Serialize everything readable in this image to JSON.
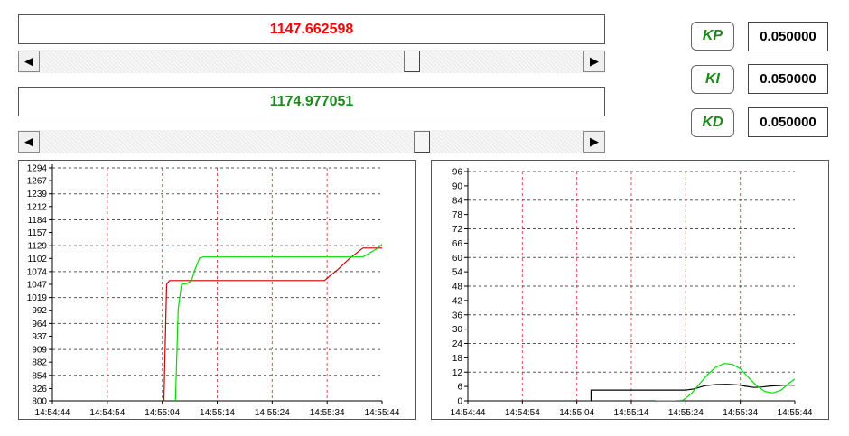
{
  "setpoint": {
    "value": "1147.662598",
    "color": "#ff0000",
    "slider_fraction": 0.69
  },
  "process_value": {
    "value": "1174.977051",
    "color": "#1a8a1a",
    "slider_fraction": 0.71
  },
  "gains": [
    {
      "label": "KP",
      "value": "0.050000"
    },
    {
      "label": "KI",
      "value": "0.050000"
    },
    {
      "label": "KD",
      "value": "0.050000"
    }
  ],
  "colors": {
    "red_series": "#cc0000",
    "green_series": "#00dd00",
    "black_series": "#000000",
    "grid_v": "#e05050",
    "grid_h": "#555555"
  },
  "icons": {
    "left_arrow": "triangle-left-icon",
    "right_arrow": "triangle-right-icon"
  },
  "chart_data": [
    {
      "type": "line",
      "x_ticks": [
        "14:54:44",
        "14:54:54",
        "14:55:04",
        "14:55:14",
        "14:55:24",
        "14:55:34",
        "14:55:44"
      ],
      "y_ticks": [
        800,
        826,
        854,
        882,
        909,
        937,
        964,
        992,
        1019,
        1047,
        1074,
        1102,
        1129,
        1157,
        1184,
        1212,
        1239,
        1267,
        1294
      ],
      "ylim": [
        800,
        1294
      ],
      "xlim": [
        0,
        60
      ],
      "grid": true,
      "series": [
        {
          "color": "#cc0000",
          "points": [
            [
              20.3,
              800
            ],
            [
              20.8,
              1047
            ],
            [
              21.3,
              1055
            ],
            [
              49.5,
              1055
            ],
            [
              52,
              1079
            ],
            [
              54,
              1101
            ],
            [
              56.5,
              1124
            ],
            [
              57.5,
              1124
            ],
            [
              60,
              1124
            ],
            [
              63,
              1124
            ],
            [
              66,
              1124
            ],
            [
              70,
              1124
            ],
            [
              72,
              1124
            ],
            [
              75,
              1124
            ],
            [
              76,
              1124
            ],
            [
              78,
              1124
            ],
            [
              82,
              1124
            ],
            [
              85,
              1124
            ],
            [
              90,
              1124
            ]
          ]
        },
        {
          "color": "#00dd00",
          "points": [
            [
              22.4,
              800
            ],
            [
              22.9,
              994
            ],
            [
              23.5,
              1047
            ],
            [
              24.5,
              1049
            ],
            [
              25.3,
              1054
            ],
            [
              26,
              1080
            ],
            [
              26.8,
              1103
            ],
            [
              27.5,
              1105
            ],
            [
              52,
              1105
            ],
            [
              56.5,
              1105
            ],
            [
              59,
              1122
            ],
            [
              61,
              1141
            ],
            [
              63.5,
              1162
            ],
            [
              65,
              1162
            ]
          ]
        }
      ]
    },
    {
      "type": "line",
      "x_ticks": [
        "14:54:44",
        "14:54:54",
        "14:55:04",
        "14:55:14",
        "14:55:24",
        "14:55:34",
        "14:55:44"
      ],
      "y_ticks": [
        0,
        6,
        12,
        18,
        24,
        30,
        36,
        42,
        48,
        54,
        60,
        66,
        72,
        78,
        84,
        90,
        96
      ],
      "ylim": [
        0,
        96
      ],
      "xlim": [
        0,
        60
      ],
      "grid": true,
      "series": [
        {
          "color": "#000000",
          "points": [
            [
              22.6,
              0
            ],
            [
              22.6,
              4.5
            ],
            [
              40,
              4.5
            ],
            [
              41.5,
              5
            ],
            [
              43.5,
              6.3
            ],
            [
              45.5,
              6.8
            ],
            [
              47.5,
              6.9
            ],
            [
              49.5,
              6.7
            ],
            [
              51,
              6.1
            ],
            [
              52.5,
              5.6
            ],
            [
              54,
              5.8
            ],
            [
              55.5,
              6.2
            ],
            [
              57,
              6.4
            ],
            [
              58.5,
              6.6
            ],
            [
              60,
              6.5
            ]
          ]
        },
        {
          "color": "#00dd00",
          "points": [
            [
              34.5,
              0
            ],
            [
              38,
              0
            ],
            [
              39.5,
              0.3
            ],
            [
              41,
              3
            ],
            [
              42.5,
              7
            ],
            [
              44,
              11
            ],
            [
              45.5,
              14.1
            ],
            [
              47,
              15.6
            ],
            [
              48.5,
              15.3
            ],
            [
              50,
              13.4
            ],
            [
              51.5,
              9.8
            ],
            [
              53,
              6.3
            ],
            [
              54.5,
              3.9
            ],
            [
              56,
              3.3
            ],
            [
              57.5,
              4.5
            ],
            [
              59,
              7.5
            ],
            [
              60,
              9.1
            ]
          ]
        }
      ]
    }
  ]
}
